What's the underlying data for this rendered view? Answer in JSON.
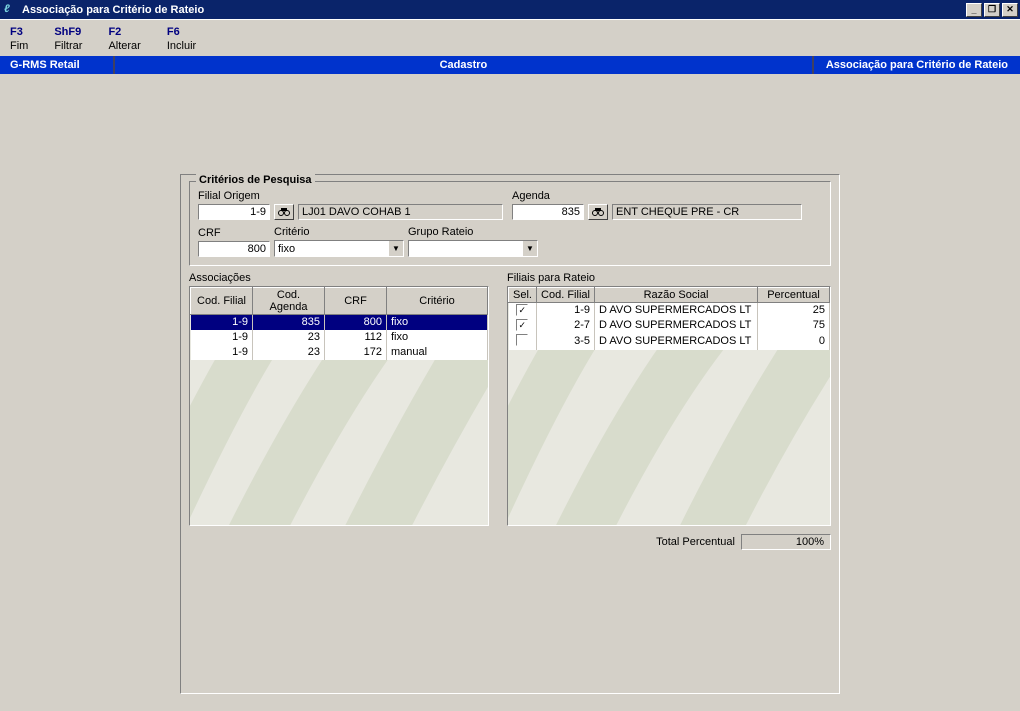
{
  "window": {
    "title": "Associação para Critério de Rateio"
  },
  "fnkeys": [
    {
      "key": "F3",
      "label": "Fim"
    },
    {
      "key": "ShF9",
      "label": "Filtrar"
    },
    {
      "key": "F2",
      "label": "Alterar"
    },
    {
      "key": "F6",
      "label": "Incluir"
    }
  ],
  "subbar": {
    "left": "G-RMS Retail",
    "center": "Cadastro",
    "right": "Associação para Critério de Rateio"
  },
  "criteria": {
    "legend": "Critérios de Pesquisa",
    "filial_origem_label": "Filial Origem",
    "filial_origem_value": "1-9",
    "filial_origem_name": "LJ01 DAVO COHAB 1",
    "agenda_label": "Agenda",
    "agenda_value": "835",
    "agenda_name": "ENT CHEQUE PRE - CR",
    "crf_label": "CRF",
    "crf_value": "800",
    "criterio_label": "Critério",
    "criterio_value": "fixo",
    "grupo_label": "Grupo Rateio",
    "grupo_value": ""
  },
  "assoc": {
    "label": "Associações",
    "headers": {
      "cod_filial": "Cod. Filial",
      "cod_agenda": "Cod. Agenda",
      "crf": "CRF",
      "criterio": "Critério"
    },
    "rows": [
      {
        "cod_filial": "1-9",
        "cod_agenda": "835",
        "crf": "800",
        "criterio": "fixo",
        "selected": true
      },
      {
        "cod_filial": "1-9",
        "cod_agenda": "23",
        "crf": "112",
        "criterio": "fixo",
        "selected": false
      },
      {
        "cod_filial": "1-9",
        "cod_agenda": "23",
        "crf": "172",
        "criterio": "manual",
        "selected": false
      }
    ]
  },
  "filiais": {
    "label": "Filiais para Rateio",
    "headers": {
      "sel": "Sel.",
      "cod_filial": "Cod. Filial",
      "razao": "Razão Social",
      "perc": "Percentual"
    },
    "rows": [
      {
        "sel": true,
        "cod_filial": "1-9",
        "razao": "D AVO SUPERMERCADOS LT",
        "perc": "25"
      },
      {
        "sel": true,
        "cod_filial": "2-7",
        "razao": "D AVO SUPERMERCADOS LT",
        "perc": "75"
      },
      {
        "sel": false,
        "cod_filial": "3-5",
        "razao": "D AVO SUPERMERCADOS LT",
        "perc": "0"
      }
    ]
  },
  "footer": {
    "total_label": "Total Percentual",
    "total_value": "100%"
  }
}
